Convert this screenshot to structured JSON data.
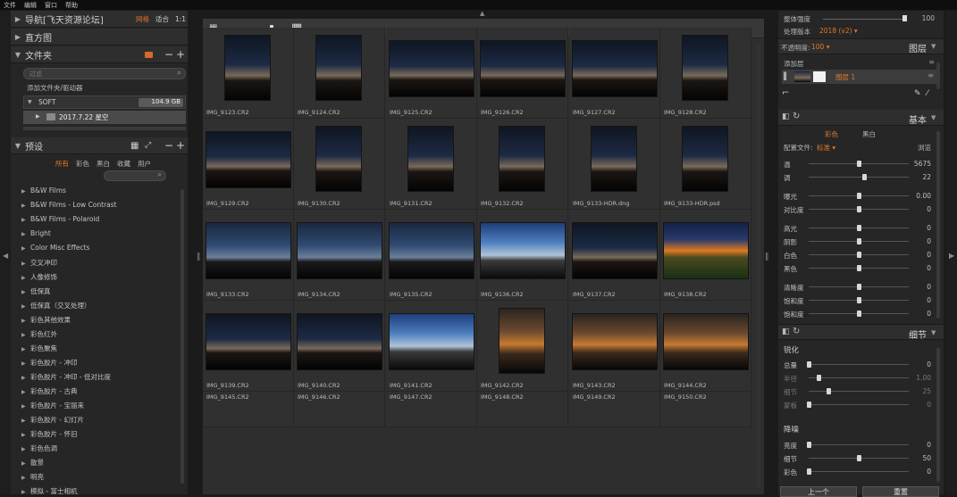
{
  "menu": [
    "文件",
    "编辑",
    "窗口",
    "帮助"
  ],
  "left": {
    "nav": {
      "title": "导航[飞天资源论坛]",
      "grid": "网格",
      "fit": "适合",
      "ratio": "1:1"
    },
    "histogram": {
      "title": "直方图"
    },
    "folders": {
      "title": "文件夹",
      "filter_placeholder": "过滤",
      "add_label": "添加文件夹/驱动器",
      "drive": "SOFT",
      "drive_size": "104.9 GB",
      "folder": "2017.7.22 星空"
    },
    "presets": {
      "title": "预设",
      "tabs": [
        "所有",
        "彩色",
        "黑白",
        "收藏",
        "用户"
      ],
      "items": [
        "B&W Films",
        "B&W Films - Low Contrast",
        "B&W Films - Polaroid",
        "Bright",
        "Color Misc Effects",
        "交叉冲印",
        "人像修饰",
        "低保真",
        "低保真（交叉处理）",
        "彩色其他效果",
        "彩色红外",
        "彩色聚焦",
        "彩色胶片 - 冲印",
        "彩色胶片 - 冲印 - 低对比度",
        "彩色胶片 - 古典",
        "彩色胶片 - 宝丽来",
        "彩色胶片 - 幻灯片",
        "彩色胶片 - 怀旧",
        "彩色色调",
        "散景",
        "明亮",
        "模拟 - 富士相机"
      ]
    }
  },
  "grid": {
    "rows": [
      {
        "labels": [
          "IMG_9123.CR2",
          "IMG_9124.CR2",
          "IMG_9125.CR2",
          "IMG_9126.CR2",
          "IMG_9127.CR2",
          "IMG_9128.CR2"
        ],
        "styles": [
          "t-dusk",
          "t-dusk",
          "t-dusk",
          "t-dusk",
          "t-dusk",
          "t-dusk"
        ],
        "orient": [
          "p",
          "p",
          "l",
          "l",
          "l",
          "p"
        ]
      },
      {
        "labels": [
          "IMG_9129.CR2",
          "IMG_9130.CR2",
          "IMG_9131.CR2",
          "IMG_9132.CR2",
          "IMG_9133-HDR.dng",
          "IMG_9133-HDR.psd"
        ],
        "styles": [
          "t-dusk",
          "t-dusk",
          "t-dusk",
          "t-dusk",
          "t-dusk",
          "t-dusk"
        ],
        "orient": [
          "l",
          "p",
          "p",
          "p",
          "p",
          "p"
        ]
      },
      {
        "labels": [
          "IMG_9133.CR2",
          "IMG_9134.CR2",
          "IMG_9135.CR2",
          "IMG_9136.CR2",
          "IMG_9137.CR2",
          "IMG_9138.CR2"
        ],
        "styles": [
          "t-blue",
          "t-blue",
          "t-blue",
          "t-bright",
          "t-dusk",
          "t-hdr"
        ],
        "orient": [
          "l",
          "l",
          "l",
          "l",
          "l",
          "l"
        ]
      },
      {
        "labels": [
          "IMG_9139.CR2",
          "IMG_9140.CR2",
          "IMG_9141.CR2",
          "IMG_9142.CR2",
          "IMG_9143.CR2",
          "IMG_9144.CR2"
        ],
        "styles": [
          "t-dusk",
          "t-dusk",
          "t-bright",
          "t-warm",
          "t-warm",
          "t-warm"
        ],
        "orient": [
          "l",
          "l",
          "l",
          "p",
          "l",
          "l"
        ]
      },
      {
        "labels": [
          "IMG_9145.CR2",
          "IMG_9146.CR2",
          "IMG_9147.CR2",
          "IMG_9148.CR2",
          "IMG_9149.CR2",
          "IMG_9150.CR2"
        ],
        "styles": [
          "t-gold",
          "t-gold",
          "t-gold",
          "t-gold",
          "t-gold",
          "t-gold"
        ],
        "orient": [
          "l",
          "l",
          "l",
          "l",
          "p",
          "p"
        ]
      }
    ]
  },
  "right": {
    "top": {
      "overall_label": "整体强度",
      "overall_value": "100",
      "process_label": "处理版本",
      "process_value": "2018 (v2)",
      "opacity_label": "不透明度:",
      "opacity_value": "100",
      "layers_title": "图层",
      "add_layer": "添加层",
      "layer_name": "图层 1"
    },
    "basic": {
      "title": "基本",
      "tab_color": "彩色",
      "tab_bw": "黑白",
      "profile_label": "配置文件:",
      "profile_value": "标准",
      "browse": "浏览"
    },
    "sliders": [
      {
        "name": "温",
        "value": "5675"
      },
      {
        "name": "调",
        "value": "22"
      },
      {
        "name": "曝光",
        "value": "0.00"
      },
      {
        "name": "对比度",
        "value": "0"
      },
      {
        "name": "高光",
        "value": "0"
      },
      {
        "name": "阴影",
        "value": "0"
      },
      {
        "name": "白色",
        "value": "0"
      },
      {
        "name": "黑色",
        "value": "0"
      },
      {
        "name": "清晰度",
        "value": "0"
      },
      {
        "name": "饱和度",
        "value": "0"
      },
      {
        "name": "饱和度",
        "value": "0"
      }
    ],
    "detail": {
      "title": "细节",
      "sharpen": "锐化",
      "noise": "降噪",
      "next": "上一个",
      "reset": "重置"
    },
    "sharpen_sliders": [
      {
        "name": "总量",
        "value": "0"
      },
      {
        "name": "半径",
        "value": "1.00"
      },
      {
        "name": "细节",
        "value": "25"
      },
      {
        "name": "蒙板",
        "value": "0"
      }
    ],
    "noise_sliders": [
      {
        "name": "亮度",
        "value": "0"
      },
      {
        "name": "细节",
        "value": "50"
      },
      {
        "name": "彩色",
        "value": "0"
      }
    ]
  }
}
